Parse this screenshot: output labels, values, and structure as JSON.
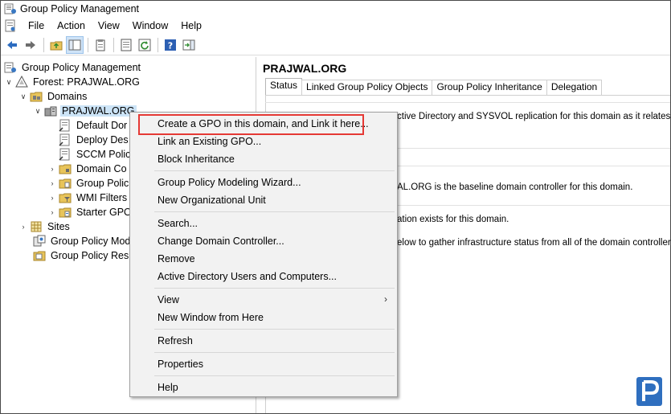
{
  "window": {
    "title": "Group Policy Management"
  },
  "menubar": {
    "items": [
      "File",
      "Action",
      "View",
      "Window",
      "Help"
    ]
  },
  "tree": {
    "root": "Group Policy Management",
    "forest": "Forest: PRAJWAL.ORG",
    "domains": "Domains",
    "domain": "PRAJWAL.ORG",
    "children": [
      "Default Dor",
      "Deploy Des",
      "SCCM Polic",
      "Domain Co",
      "Group Polic",
      "WMI Filters",
      "Starter GPO"
    ],
    "sites": "Sites",
    "modeling": "Group Policy Mode",
    "results": "Group Policy Resul"
  },
  "right": {
    "title": "PRAJWAL.ORG",
    "tabs": [
      "Status",
      "Linked Group Policy Objects",
      "Group Policy Inheritance",
      "Delegation"
    ],
    "text1": "ctive Directory and SYSVOL replication for this domain as it relates to Gr",
    "text2": "AL.ORG is the baseline domain controller for this domain.",
    "text3": "ation exists for this domain.",
    "text4": "elow to gather infrastructure status from all of the domain controllers in thi"
  },
  "context_menu": {
    "items": [
      "Create a GPO in this domain, and Link it here...",
      "Link an Existing GPO...",
      "Block Inheritance",
      "Group Policy Modeling Wizard...",
      "New Organizational Unit",
      "Search...",
      "Change Domain Controller...",
      "Remove",
      "Active Directory Users and Computers...",
      "View",
      "New Window from Here",
      "Refresh",
      "Properties",
      "Help"
    ],
    "highlight_color": "#e53935"
  },
  "colors": {
    "selection": "#cce4f7",
    "menu_bg": "#f2f2f2",
    "brand": "#2f6fbf"
  }
}
